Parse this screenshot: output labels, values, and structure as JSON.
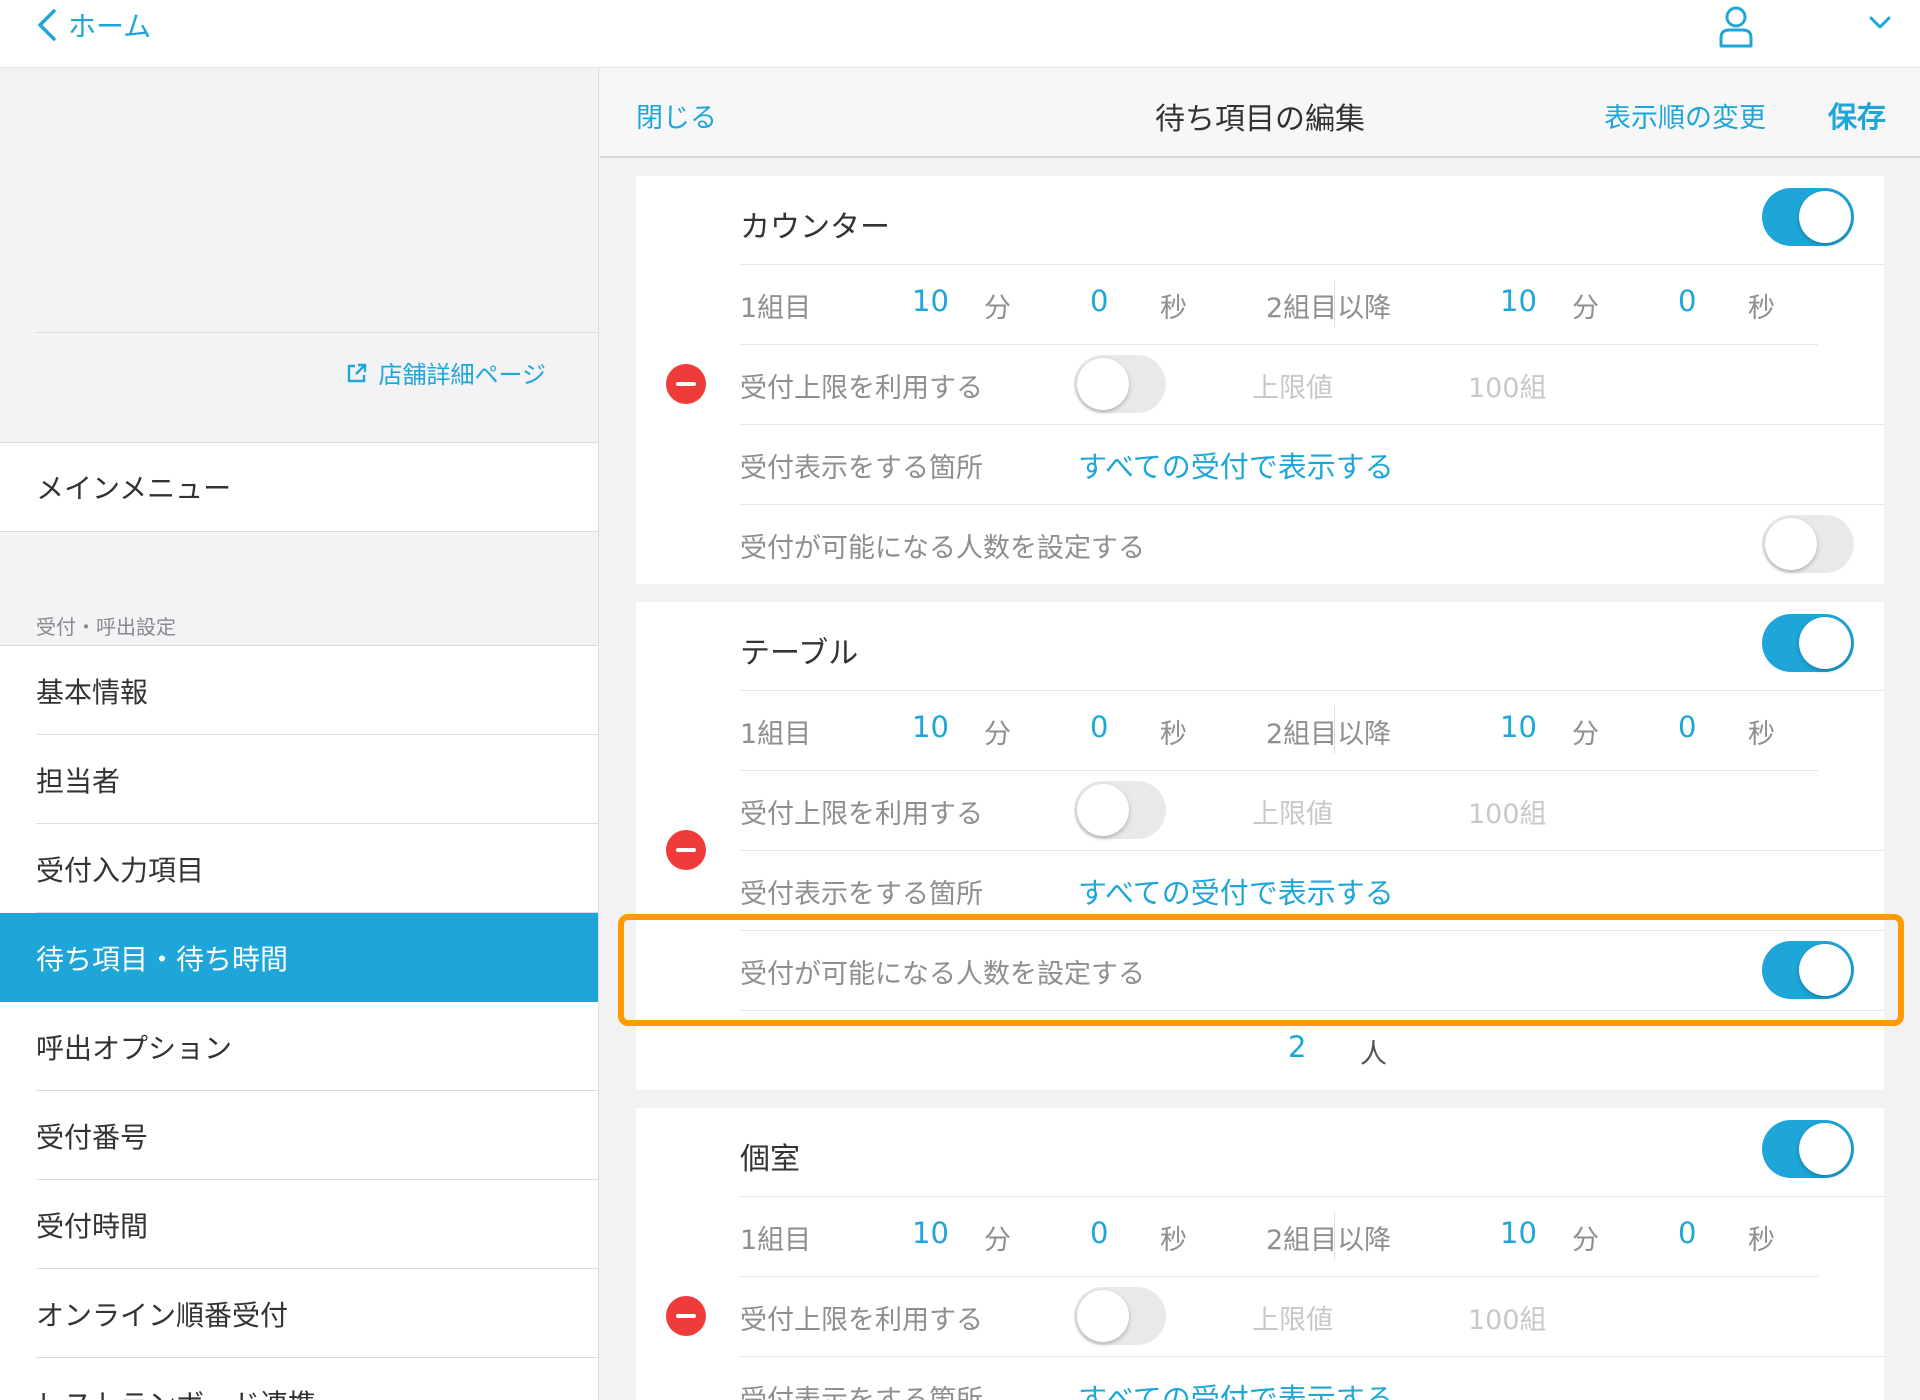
{
  "topbar": {
    "back_label": "ホーム"
  },
  "sidebar": {
    "shop_link": "店舗詳細ページ",
    "main_menu": "メインメニュー",
    "section_label": "受付・呼出設定",
    "items": [
      {
        "label": "基本情報",
        "active": false
      },
      {
        "label": "担当者",
        "active": false
      },
      {
        "label": "受付入力項目",
        "active": false
      },
      {
        "label": "待ち項目・待ち時間",
        "active": true
      },
      {
        "label": "呼出オプション",
        "active": false
      },
      {
        "label": "受付番号",
        "active": false
      },
      {
        "label": "受付時間",
        "active": false
      },
      {
        "label": "オンライン順番受付",
        "active": false
      },
      {
        "label": "レストランボード連携",
        "active": false
      }
    ]
  },
  "header": {
    "close_label": "閉じる",
    "title": "待ち項目の編集",
    "reorder_label": "表示順の変更",
    "save_label": "保存"
  },
  "labels": {
    "first_group": "1組目",
    "after_second": "2組目以降",
    "minutes": "分",
    "seconds": "秒",
    "limit_use": "受付上限を利用する",
    "limit_value": "上限値",
    "display_location": "受付表示をする箇所",
    "display_location_value": "すべての受付で表示する",
    "capacity_setting": "受付が可能になる人数を設定する",
    "people_unit": "人"
  },
  "cards": [
    {
      "name": "カウンター",
      "enabled": true,
      "first_min": "10",
      "first_sec": "0",
      "after_min": "10",
      "after_sec": "0",
      "limit_enabled": false,
      "limit_value": "100組",
      "capacity_enabled": false
    },
    {
      "name": "テーブル",
      "enabled": true,
      "first_min": "10",
      "first_sec": "0",
      "after_min": "10",
      "after_sec": "0",
      "limit_enabled": false,
      "limit_value": "100組",
      "capacity_enabled": true,
      "capacity_value": "2"
    },
    {
      "name": "個室",
      "enabled": true,
      "first_min": "10",
      "first_sec": "0",
      "after_min": "10",
      "after_sec": "0",
      "limit_enabled": false,
      "limit_value": "100組"
    }
  ],
  "colors": {
    "accent": "#1ea6d9",
    "highlight": "#ff9a00",
    "delete": "#f03b3b"
  }
}
